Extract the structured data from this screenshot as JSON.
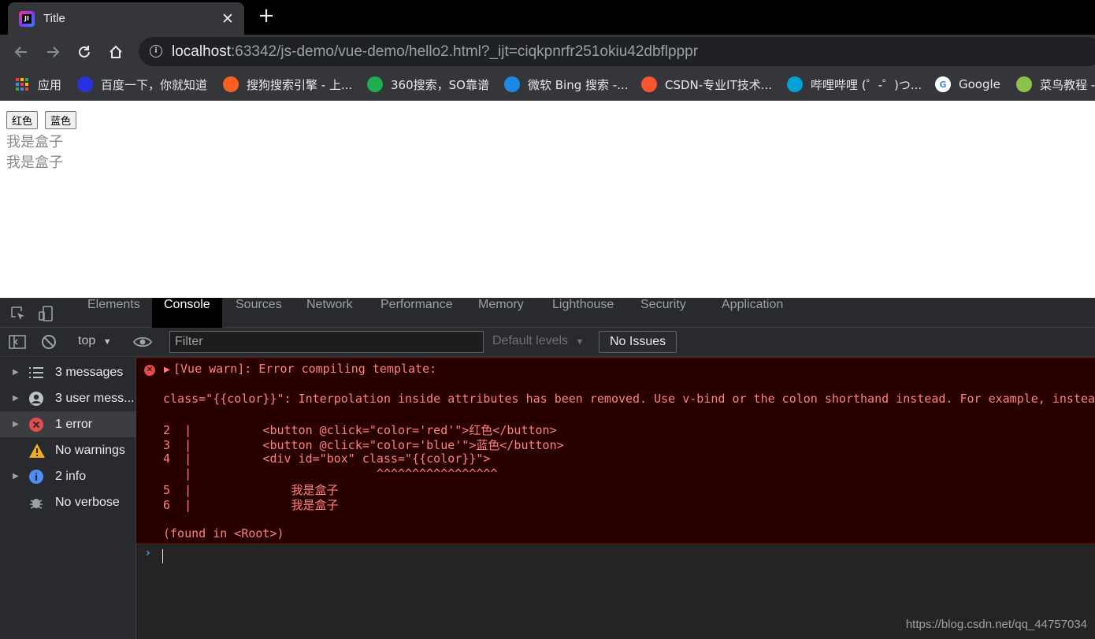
{
  "browser": {
    "tab_title": "Title",
    "tab_close": "✕",
    "new_tab": "+",
    "url_host": "localhost",
    "url_rest": ":63342/js-demo/vue-demo/hello2.html?_ijt=ciqkpnrfr251okiu42dbflpppr",
    "bookmarks": [
      {
        "label": "应用",
        "icon": "apps-grid-icon",
        "color": "#ea4335"
      },
      {
        "label": "百度一下，你就知道",
        "icon": "baidu-icon",
        "color": "#2932e1"
      },
      {
        "label": "搜狗搜索引擎 - 上...",
        "icon": "sogou-icon",
        "color": "#fb6022"
      },
      {
        "label": "360搜索，SO靠谱",
        "icon": "360-icon",
        "color": "#1ead4f"
      },
      {
        "label": "微软 Bing 搜索 -...",
        "icon": "bing-icon",
        "color": "#1e88e5"
      },
      {
        "label": "CSDN-专业IT技术...",
        "icon": "csdn-icon",
        "color": "#fc5531"
      },
      {
        "label": "哔哩哔哩 (゜-゜)つ...",
        "icon": "bilibili-icon",
        "color": "#00a1d6"
      },
      {
        "label": "Google",
        "icon": "google-icon",
        "color": "#4285f4"
      },
      {
        "label": "菜鸟教程 -",
        "icon": "runoob-icon",
        "color": "#8bc34a"
      }
    ]
  },
  "page": {
    "btn_red": "红色",
    "btn_blue": "蓝色",
    "box_lines": [
      "我是盒子",
      "我是盒子"
    ]
  },
  "devtools": {
    "tabs": [
      "Elements",
      "Console",
      "Sources",
      "Network",
      "Performance",
      "Memory",
      "Lighthouse",
      "Security",
      "Application"
    ],
    "active_tab": "Console",
    "context": "top",
    "filter_placeholder": "Filter",
    "levels": "Default levels",
    "issues": "No Issues",
    "sidebar": [
      {
        "label": "3 messages",
        "icon": "list-icon"
      },
      {
        "label": "3 user mess...",
        "icon": "user-icon"
      },
      {
        "label": "1 error",
        "icon": "error-icon"
      },
      {
        "label": "No warnings",
        "icon": "warning-icon"
      },
      {
        "label": "2 info",
        "icon": "info-icon"
      },
      {
        "label": "No verbose",
        "icon": "bug-icon"
      }
    ],
    "console_lines": [
      "[Vue warn]: Error compiling template:",
      "class=\"{{color}}\": Interpolation inside attributes has been removed. Use v-bind or the colon shorthand instead. For example, instea",
      "2  |          <button @click=\"color='red'\">红色</button>",
      "3  |          <button @click=\"color='blue'\">蓝色</button>",
      "4  |          <div id=\"box\" class=\"{{color}}\">",
      "   |                          ^^^^^^^^^^^^^^^^^",
      "5  |              我是盒子",
      "6  |              我是盒子",
      "(found in <Root>)"
    ]
  },
  "watermark": "https://blog.csdn.net/qq_44757034"
}
